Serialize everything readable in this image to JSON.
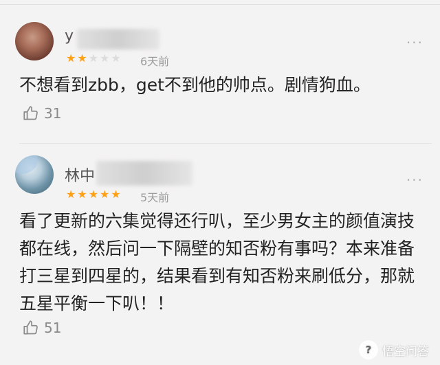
{
  "reviews": [
    {
      "username": "y",
      "rating": 2,
      "stars": [
        "on",
        "on",
        "off",
        "off",
        "off"
      ],
      "time": "6天前",
      "content": "不想看到zbb，get不到他的帅点。剧情狗血。",
      "likes": "31",
      "more": "···"
    },
    {
      "username": "林中",
      "rating": 5,
      "stars": [
        "on",
        "on",
        "on",
        "on",
        "on"
      ],
      "time": "5天前",
      "content": "看了更新的六集觉得还行叭，至少男女主的颜值演技都在线，然后问一下隔壁的知否粉有事吗？本来准备打三星到四星的，结果看到有知否粉来刷低分，那就五星平衡一下叭！！",
      "likes": "51",
      "more": "···"
    }
  ],
  "star_glyph": "★",
  "colors": {
    "star_on": "#ffa015",
    "star_off": "#dcdcdc",
    "text": "#222222",
    "muted": "#9c9c9c"
  },
  "icons": {
    "like": "thumbs-up-icon",
    "more": "more-dots-icon"
  },
  "watermark": {
    "text": "悟空问答"
  }
}
